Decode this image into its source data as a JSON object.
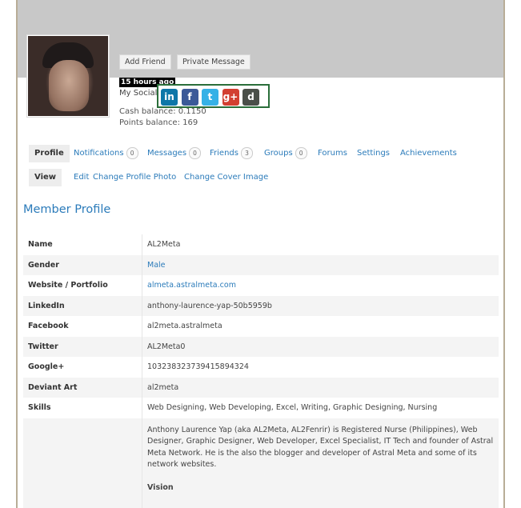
{
  "header": {
    "add_friend": "Add Friend",
    "private_message": "Private Message",
    "last_active": "15 hours ago",
    "social_label": "My Social",
    "social_icons": [
      {
        "name": "linkedin-icon",
        "glyph": "in",
        "color": "#0e76a8"
      },
      {
        "name": "facebook-icon",
        "glyph": "f",
        "color": "#3b5998"
      },
      {
        "name": "twitter-icon",
        "glyph": "t",
        "color": "#35b1e6"
      },
      {
        "name": "google-plus-icon",
        "glyph": "g+",
        "color": "#d23f31"
      },
      {
        "name": "deviantart-icon",
        "glyph": "d",
        "color": "#4a4f49"
      }
    ],
    "cash_balance": "Cash balance: 0.1150",
    "points_balance": "Points balance: 169"
  },
  "tabs": [
    {
      "label": "Profile",
      "count": null,
      "active": true
    },
    {
      "label": "Notifications",
      "count": "0"
    },
    {
      "label": "Messages",
      "count": "0"
    },
    {
      "label": "Friends",
      "count": "3"
    },
    {
      "label": "Groups",
      "count": "0"
    },
    {
      "label": "Forums",
      "count": null
    },
    {
      "label": "Settings",
      "count": null
    },
    {
      "label": "Achievements",
      "count": null
    }
  ],
  "subtabs": [
    {
      "label": "View",
      "active": true
    },
    {
      "label": "Edit"
    },
    {
      "label": "Change Profile Photo"
    },
    {
      "label": "Change Cover Image"
    }
  ],
  "section_title": "Member Profile",
  "fields": [
    {
      "key": "Name",
      "value": "AL2Meta",
      "link": false
    },
    {
      "key": "Gender",
      "value": "Male",
      "link": true
    },
    {
      "key": "Website / Portfolio",
      "value": "almeta.astralmeta.com",
      "link": true
    },
    {
      "key": "LinkedIn",
      "value": "anthony-laurence-yap-50b5959b",
      "link": false
    },
    {
      "key": "Facebook",
      "value": "al2meta.astralmeta",
      "link": false
    },
    {
      "key": "Twitter",
      "value": "AL2Meta0",
      "link": false
    },
    {
      "key": "Google+",
      "value": "103238323739415894324",
      "link": false
    },
    {
      "key": "Deviant Art",
      "value": "al2meta",
      "link": false
    },
    {
      "key": "Skills",
      "value": "Web Designing, Web Developing, Excel, Writing, Graphic Designing, Nursing",
      "link": false
    }
  ],
  "bio": {
    "text": "Anthony Laurence Yap (aka AL2Meta, AL2Fenrir) is Registered Nurse (Philippines), Web Designer, Graphic Designer, Web Developer, Excel Specialist, IT Tech and founder of Astral Meta Network. He is the also the blogger and developer of Astral Meta and some of its network websites.",
    "vision_heading": "Vision"
  }
}
